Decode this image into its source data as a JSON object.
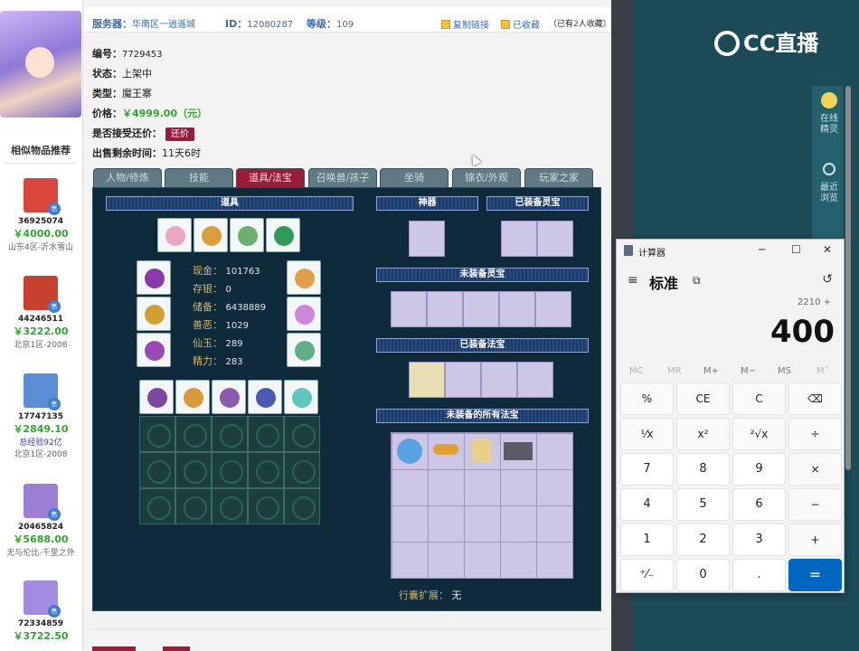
{
  "header": {
    "server_label": "服务器：",
    "server_value": "华南区一逍遥城",
    "id_label": "ID：",
    "id_value": "12080287",
    "level_label": "等级：",
    "level_value": "109",
    "copy_link": "复制链接",
    "favorited": "已收藏",
    "fav_count_prefix": "（已有",
    "fav_count": "2",
    "fav_count_suffix": "人收藏）"
  },
  "listing": {
    "number_label": "编号：",
    "number_value": "7729453",
    "status_label": "状态：",
    "status_value": "上架中",
    "type_label": "类型：",
    "type_value": "魔王寨",
    "price_label": "价格：",
    "price_value": "￥4999.00（元）",
    "counteroffer_label": "是否接受还价：",
    "counteroffer_button": "还价",
    "remaining_label": "出售剩余时间：",
    "remaining_value": "11天6时"
  },
  "similar": {
    "title": "相似物品推荐",
    "items": [
      {
        "id": "36925074",
        "price": "￥4000.00",
        "extra": "",
        "server": "山东4区-沂水雪山",
        "badge": "售",
        "color": "#d9463c"
      },
      {
        "id": "44246511",
        "price": "￥3222.00",
        "extra": "",
        "server": "北京1区-2008",
        "badge": "售",
        "color": "#c8402e"
      },
      {
        "id": "17747135",
        "price": "￥2849.10",
        "extra": "总经验92亿",
        "server": "北京1区-2008",
        "badge": "售",
        "color": "#5a8ed6"
      },
      {
        "id": "20465824",
        "price": "￥5688.00",
        "extra": "",
        "server": "无与伦比-千里之外",
        "badge": "售",
        "color": "#9b7fd4"
      },
      {
        "id": "72334859",
        "price": "￥3722.50",
        "extra": "",
        "server": "",
        "badge": "售",
        "color": "#a28be0"
      }
    ]
  },
  "tabs": [
    "人物/修炼",
    "技能",
    "道具/法宝",
    "召唤兽/孩子",
    "坐骑",
    "锦衣/外观",
    "玩家之家"
  ],
  "active_tab": "道具/法宝",
  "panel": {
    "items_title": "道具",
    "artifact_title": "神器",
    "equipped_spirit_title": "已装备灵宝",
    "unequipped_spirit_title": "未装备灵宝",
    "equipped_treasure_title": "已装备法宝",
    "unequipped_treasure_title": "未装备的所有法宝",
    "bag_expand_label": "行囊扩展：",
    "bag_expand_value": "无",
    "stats": [
      {
        "label": "现金：",
        "value": "101763"
      },
      {
        "label": "存银：",
        "value": "0"
      },
      {
        "label": "储备：",
        "value": "6438889"
      },
      {
        "label": "善恶：",
        "value": "1029"
      },
      {
        "label": "仙玉：",
        "value": "289"
      },
      {
        "label": "精力：",
        "value": "283"
      }
    ]
  },
  "right_app": {
    "logo": "CC直播",
    "tools": [
      {
        "label": "在线精灵",
        "icon": "avatar-icon"
      },
      {
        "label": "最近浏览",
        "icon": "clock-icon"
      }
    ]
  },
  "calculator": {
    "title": "计算器",
    "mode": "标准",
    "expression": "2210 +",
    "display": "400",
    "memory": [
      "MC",
      "MR",
      "M+",
      "M−",
      "MS",
      "M˅"
    ],
    "keys": [
      [
        "%",
        "CE",
        "C",
        "⌫"
      ],
      [
        "¹⁄x",
        "x²",
        "²√x",
        "÷"
      ],
      [
        "7",
        "8",
        "9",
        "×"
      ],
      [
        "4",
        "5",
        "6",
        "−"
      ],
      [
        "1",
        "2",
        "3",
        "+"
      ],
      [
        "⁺⁄₋",
        "0",
        ".",
        "="
      ]
    ]
  }
}
